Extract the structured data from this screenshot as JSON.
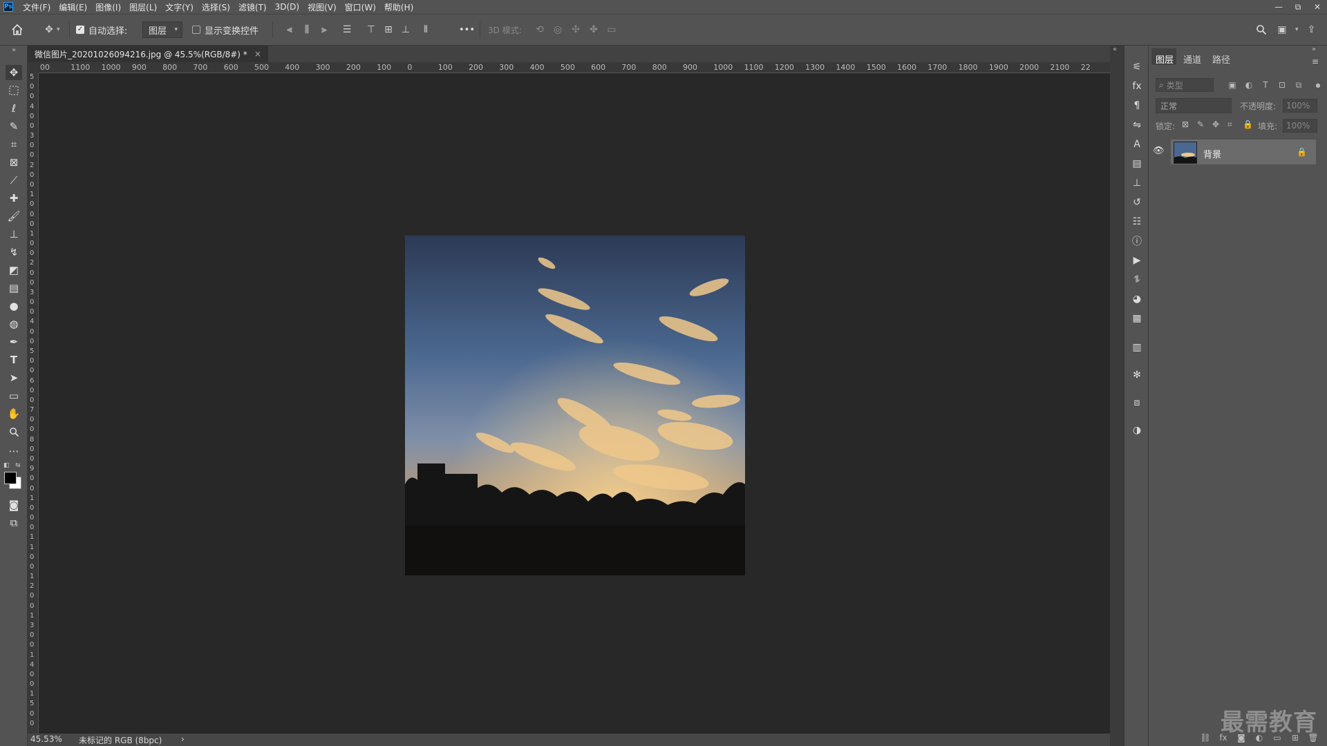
{
  "app": {
    "logo": "Ps"
  },
  "menu": [
    "文件(F)",
    "编辑(E)",
    "图像(I)",
    "图层(L)",
    "文字(Y)",
    "选择(S)",
    "滤镜(T)",
    "3D(D)",
    "视图(V)",
    "窗口(W)",
    "帮助(H)"
  ],
  "window_controls": {
    "minimize": "—",
    "restore": "⧉",
    "close": "✕"
  },
  "options": {
    "auto_select_label": "自动选择:",
    "auto_select_checked": true,
    "layer_dropdown": "图层",
    "show_transform_label": "显示变换控件",
    "show_transform_checked": false,
    "mode_3d_label": "3D 模式:",
    "more": "•••"
  },
  "document": {
    "tab_title": "微信图片_20201026094216.jpg @ 45.5%(RGB/8#) *",
    "close_glyph": "×"
  },
  "ruler": {
    "horizontal": [
      "00",
      "1100",
      "1000",
      "900",
      "800",
      "700",
      "600",
      "500",
      "400",
      "300",
      "200",
      "100",
      "0",
      "100",
      "200",
      "300",
      "400",
      "500",
      "600",
      "700",
      "800",
      "900",
      "1000",
      "1100",
      "1200",
      "1300",
      "1400",
      "1500",
      "1600",
      "1700",
      "1800",
      "1900",
      "2000",
      "2100",
      "22"
    ],
    "vertical": [
      "5",
      "0",
      "0",
      "4",
      "0",
      "0",
      "3",
      "0",
      "0",
      "2",
      "0",
      "0",
      "1",
      "0",
      "0",
      "0",
      "1",
      "0",
      "0",
      "2",
      "0",
      "0",
      "3",
      "0",
      "0",
      "4",
      "0",
      "0",
      "5",
      "0",
      "0",
      "6",
      "0",
      "0",
      "7",
      "0",
      "0",
      "8",
      "0",
      "0",
      "9",
      "0",
      "0",
      "1",
      "0",
      "0",
      "0",
      "1",
      "1",
      "0",
      "0",
      "1",
      "2",
      "0",
      "0",
      "1",
      "3",
      "0",
      "0",
      "1",
      "4",
      "0",
      "0",
      "1",
      "5",
      "0",
      "0"
    ]
  },
  "panels": {
    "tabs": [
      "图层",
      "通道",
      "路径"
    ],
    "search_placeholder": "类型",
    "blend_mode": "正常",
    "opacity_label": "不透明度:",
    "opacity_value": "100%",
    "lock_label": "锁定:",
    "fill_label": "填充:",
    "fill_value": "100%",
    "layer_name": "背景"
  },
  "status": {
    "zoom": "45.53%",
    "profile": "未标记的 RGB (8bpc)",
    "arrow": "›"
  },
  "watermark": "最需教育",
  "colors": {
    "ui_bg": "#535353",
    "canvas_bg": "#282828",
    "foreground": "#000000",
    "background": "#ffffff"
  }
}
